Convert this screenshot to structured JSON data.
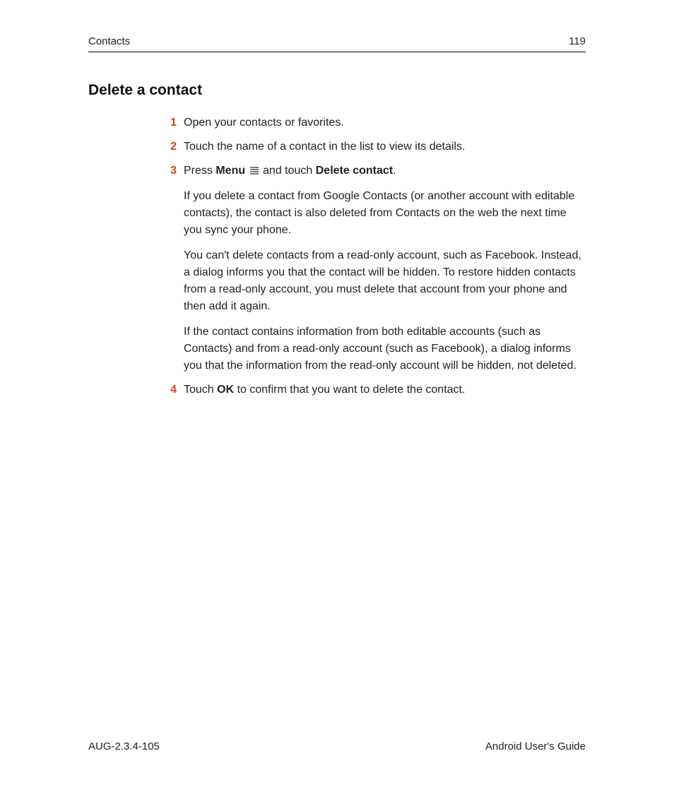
{
  "header": {
    "section": "Contacts",
    "page_number": "119"
  },
  "title": "Delete a contact",
  "steps": [
    {
      "num": "1",
      "text": "Open your contacts or favorites."
    },
    {
      "num": "2",
      "text": "Touch the name of a contact in the list to view its details."
    },
    {
      "num": "3",
      "parts": {
        "press": "Press ",
        "menu": "Menu",
        "and_touch": " and touch ",
        "delete_contact": "Delete contact",
        "period": "."
      },
      "paras": [
        "If you delete a contact from Google Contacts (or another account with editable contacts), the contact is also deleted from Contacts on the web the next time you sync your phone.",
        "You can't delete contacts from a read-only account, such as Facebook. Instead, a dialog informs you that the contact will be hidden. To restore hidden contacts from a read-only account, you must delete that account from your phone and then add it again.",
        "If the contact contains information from both editable accounts (such as Contacts) and from a read-only account (such as Facebook), a dialog informs you that the information from the read-only account will be hidden, not deleted."
      ]
    },
    {
      "num": "4",
      "parts": {
        "touch": "Touch ",
        "ok": "OK",
        "rest": " to confirm that you want to delete the contact."
      }
    }
  ],
  "footer": {
    "doc_id": "AUG-2.3.4-105",
    "guide": "Android User's Guide"
  }
}
